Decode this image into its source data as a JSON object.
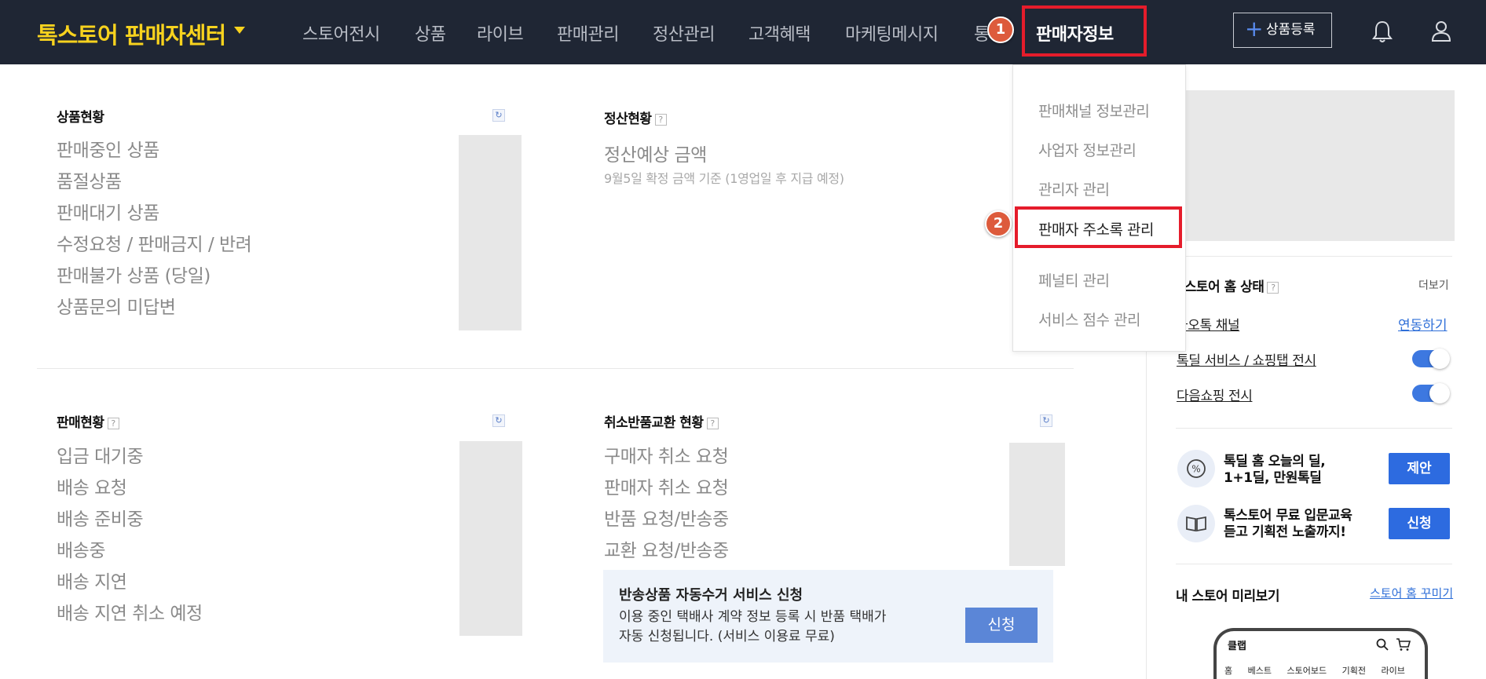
{
  "header": {
    "brand": "톡스토어 판매자센터",
    "nav": [
      "스토어전시",
      "상품",
      "라이브",
      "판매관리",
      "정산관리",
      "고객혜택",
      "마케팅메시지",
      "통"
    ],
    "active_nav": "판매자정보",
    "register_label": "상품등록"
  },
  "steps": [
    "1",
    "2"
  ],
  "dropdown": {
    "items": [
      "판매채널 정보관리",
      "사업자 정보관리",
      "관리자 관리",
      "판매자 주소록 관리",
      "페널티 관리",
      "서비스 점수 관리"
    ]
  },
  "product_status": {
    "title": "상품현황",
    "items": [
      "판매중인 상품",
      "품절상품",
      "판매대기 상품",
      "수정요청 / 판매금지 / 반려",
      "판매불가 상품 (당일)",
      "상품문의 미답변"
    ]
  },
  "settlement": {
    "title": "정산현황",
    "label": "정산예상 금액",
    "note": "9월5일 확정 금액 기준 (1영업일 후 지급 예정)"
  },
  "sales_status": {
    "title": "판매현황",
    "items": [
      "입금 대기중",
      "배송 요청",
      "배송 준비중",
      "배송중",
      "배송 지연",
      "배송 지연 취소 예정"
    ]
  },
  "claims": {
    "title": "취소반품교환 현황",
    "items": [
      "구매자 취소 요청",
      "판매자 취소 요청",
      "반품 요청/반송중",
      "교환 요청/반송중"
    ]
  },
  "promo": {
    "title": "반송상품 자동수거 서비스 신청",
    "desc1": "이용 중인 택배사 계약 정보 등록 시 반품 택배가",
    "desc2": "자동 신청됩니다. (서비스 이용료 무료)",
    "button": "신청"
  },
  "right": {
    "home_status_title": "l 스토어 홈 상태",
    "more": "더보기",
    "kakao_channel": "카오톡 채널",
    "connect": "연동하기",
    "deal_service": "톡딜 서비스 / 쇼핑탭 전시",
    "daum_shopping": "다음쇼핑 전시",
    "deal_promo_1": "톡딜 홈 오늘의 딜,",
    "deal_promo_2": "1+1딜, 만원톡딜",
    "deal_btn": "제안",
    "edu_promo_1": "톡스토어 무료 입문교육",
    "edu_promo_2": "듣고 기획전 노출까지!",
    "edu_btn": "신청",
    "preview_title": "내 스토어 미리보기",
    "decorate": "스토어 홈 꾸미기",
    "phone_title": "클랩",
    "phone_tabs": [
      "홈",
      "베스트",
      "스토어보드",
      "기획전",
      "라이브"
    ]
  }
}
